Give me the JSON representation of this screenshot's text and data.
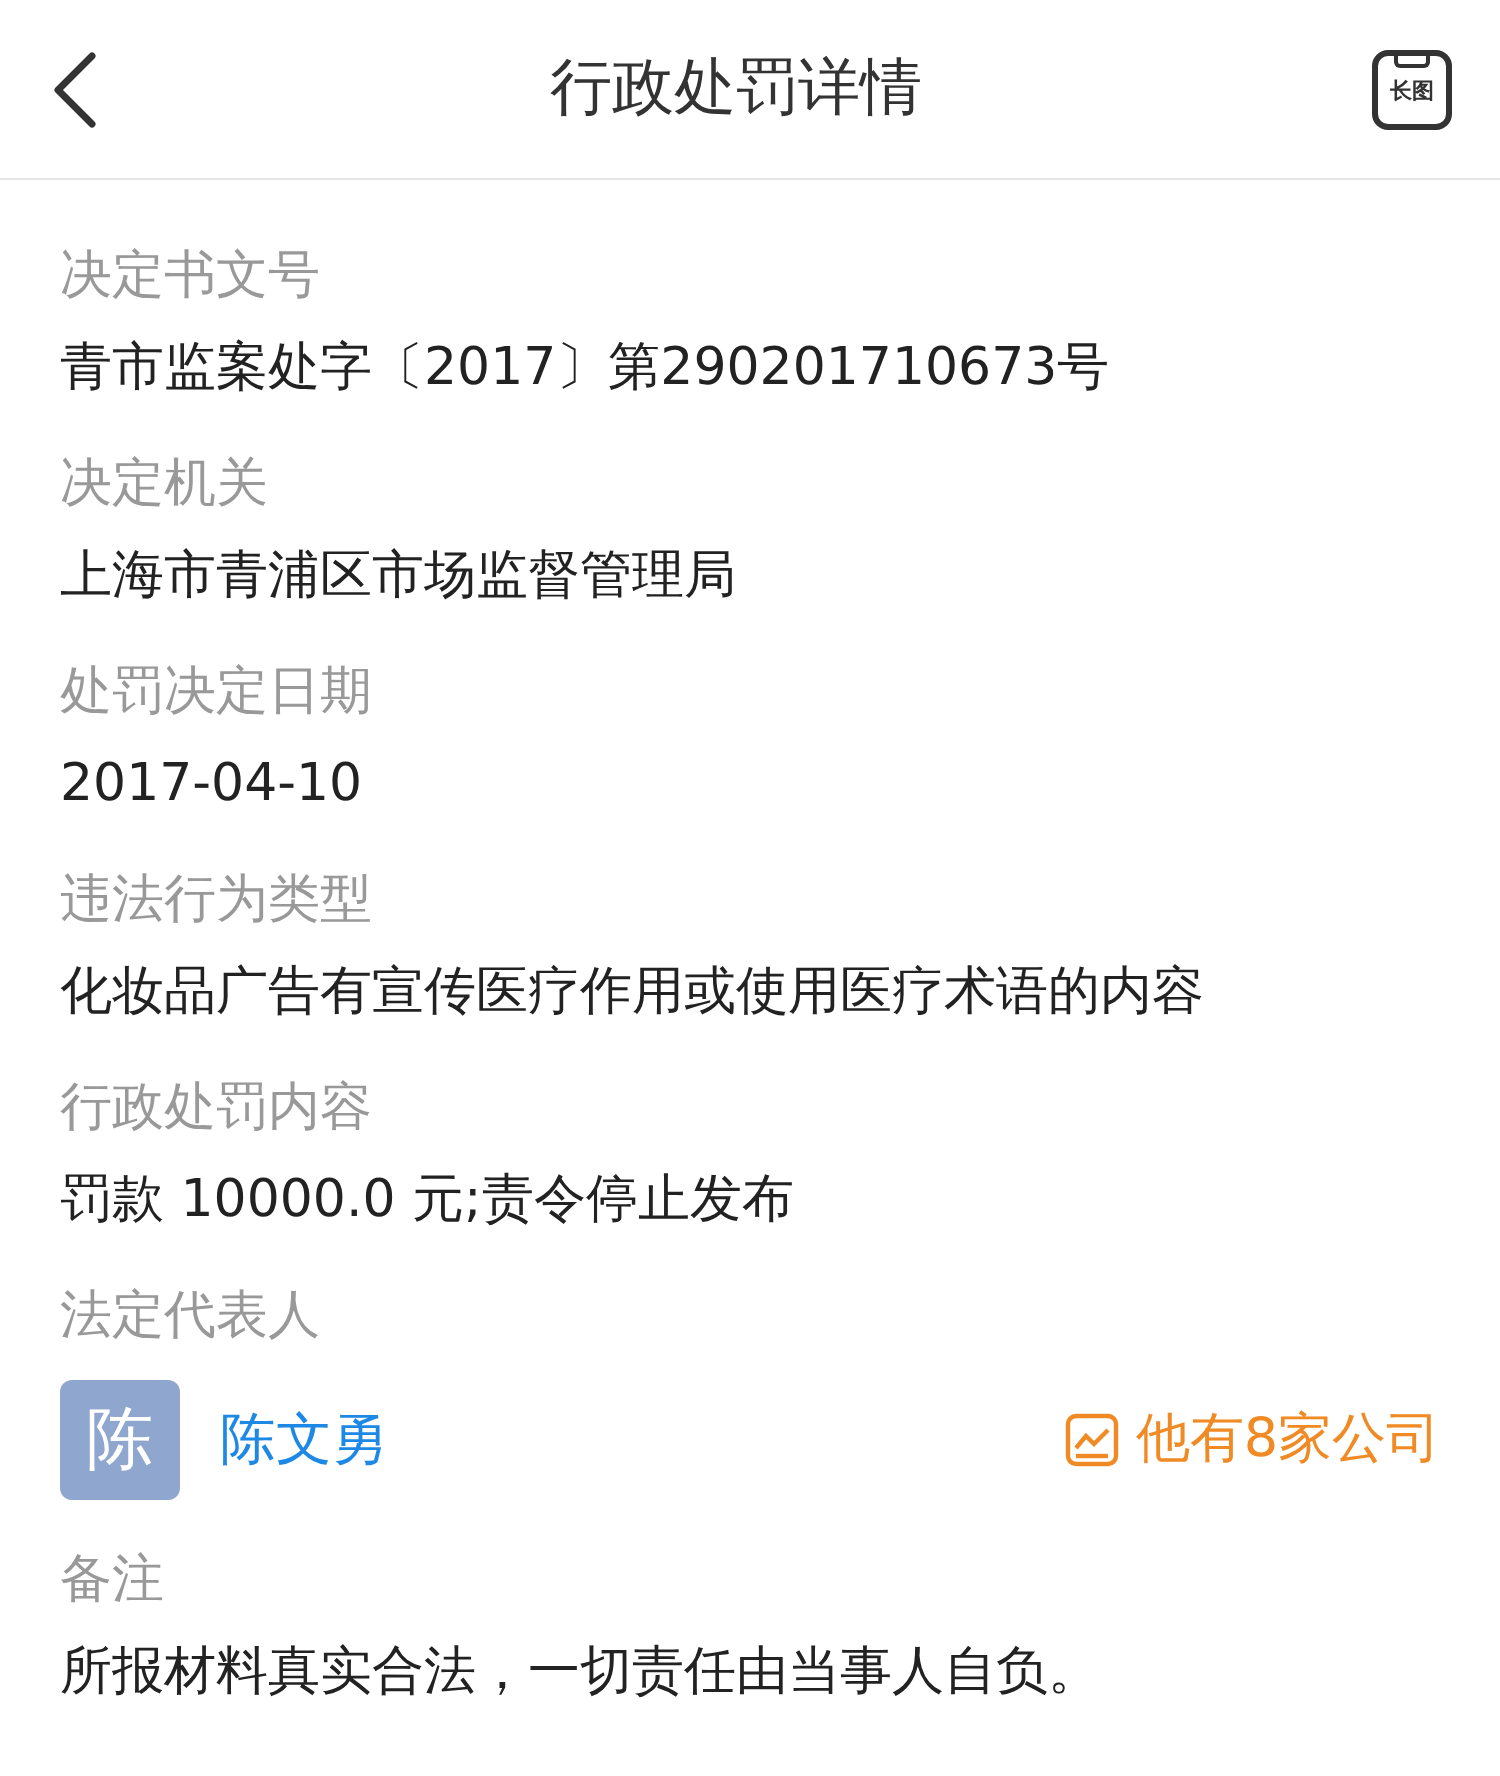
{
  "header": {
    "title": "行政处罚详情",
    "action_label": "长图"
  },
  "fields": [
    {
      "kind": "text",
      "label": "决定书文号",
      "value": "青市监案处字〔2017〕第290201710673号"
    },
    {
      "kind": "text",
      "label": "决定机关",
      "value": "上海市青浦区市场监督管理局"
    },
    {
      "kind": "text",
      "label": "处罚决定日期",
      "value": "2017-04-10"
    },
    {
      "kind": "text",
      "label": "违法行为类型",
      "value": "化妆品广告有宣传医疗作用或使用医疗术语的内容"
    },
    {
      "kind": "text",
      "label": "行政处罚内容",
      "value": "罚款 10000.0 元;责令停止发布"
    },
    {
      "kind": "person",
      "label": "法定代表人",
      "avatar": "陈",
      "name": "陈文勇",
      "link": "他有8家公司"
    },
    {
      "kind": "text",
      "label": "备注",
      "value": "所报材料真实合法，一切责任由当事人自负。"
    }
  ]
}
